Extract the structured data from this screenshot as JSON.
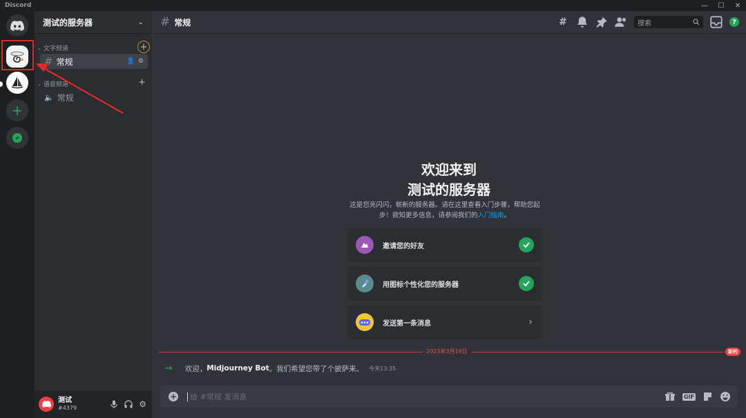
{
  "app": {
    "title": "Discord"
  },
  "window": {
    "minimize": "—",
    "maximize": "☐",
    "close": "✕"
  },
  "sidebar": {
    "server_name": "测试的服务器",
    "categories": [
      {
        "label": "文字频道",
        "channels": [
          {
            "label": "常规",
            "type": "text",
            "active": true
          }
        ]
      },
      {
        "label": "语音频道",
        "channels": [
          {
            "label": "常规",
            "type": "voice",
            "active": false
          }
        ]
      }
    ]
  },
  "user": {
    "name": "测试",
    "tag": "#4379"
  },
  "header": {
    "channel": "常规",
    "search_placeholder": "搜索",
    "help": "?"
  },
  "welcome": {
    "line1": "欢迎来到",
    "line2": "测试的服务器",
    "desc_part1": "这是您亮闪闪，崭新的服务器。请在这里查看入门步骤，帮助您起步！欲知更多信息，请参阅我们的",
    "desc_link": "入门指南",
    "desc_end": "。"
  },
  "cards": [
    {
      "label": "邀请您的好友",
      "done": true
    },
    {
      "label": "用图标个性化您的服务器",
      "done": true
    },
    {
      "label": "发送第一条消息",
      "done": false
    }
  ],
  "divider": {
    "date": "2023年3月19日",
    "new_label": "新的"
  },
  "system_message": {
    "prefix": "欢迎，",
    "bot": "Midjourney Bot",
    "suffix": "。我们希望您带了个披萨来。",
    "time": "今天13:35"
  },
  "composer": {
    "placeholder": "给 #常规 发消息",
    "gif": "GIF"
  },
  "colors": {
    "accent_green": "#23a55a",
    "annotation_red": "#e02b2b",
    "blurple_link": "#00a8fc"
  }
}
